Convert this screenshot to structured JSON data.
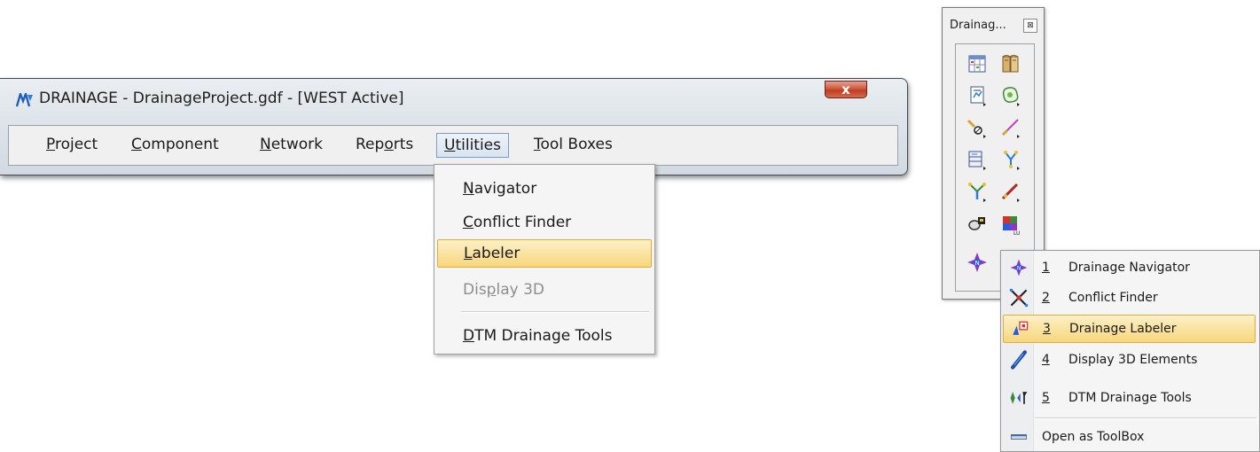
{
  "window": {
    "title": "DRAINAGE - DrainageProject.gdf - [WEST Active]",
    "close_label": "x",
    "menu": [
      {
        "pre": "",
        "key": "P",
        "post": "roject"
      },
      {
        "pre": "",
        "key": "C",
        "post": "omponent"
      },
      {
        "pre": "",
        "key": "N",
        "post": "etwork"
      },
      {
        "pre": "Rep",
        "key": "o",
        "post": "rts"
      },
      {
        "pre": "",
        "key": "U",
        "post": "tilities"
      },
      {
        "pre": "",
        "key": "T",
        "post": "ool Boxes"
      }
    ]
  },
  "utilities_menu": {
    "items": [
      {
        "pre": "",
        "key": "N",
        "post": "avigator"
      },
      {
        "pre": "",
        "key": "C",
        "post": "onflict Finder"
      },
      {
        "pre": "",
        "key": "L",
        "post": "abeler"
      },
      {
        "pre": "Dis",
        "key": "p",
        "post": "lay 3D"
      },
      {
        "pre": "",
        "key": "D",
        "post": "TM Drainage Tools"
      }
    ]
  },
  "toolbox": {
    "title": "Drainag...",
    "close_label": "⊠"
  },
  "popup": {
    "items": [
      {
        "num": "1",
        "label": "Drainage Navigator"
      },
      {
        "num": "2",
        "label": "Conflict Finder"
      },
      {
        "num": "3",
        "label": "Drainage Labeler"
      },
      {
        "num": "4",
        "label": "Display 3D Elements"
      },
      {
        "num": "5",
        "label": "DTM Drainage Tools"
      },
      {
        "num": "",
        "label": "Open as ToolBox"
      }
    ]
  },
  "colors": {
    "highlight": "#f7d77c",
    "highlight_border": "#e3ac3a",
    "close_red": "#c03e22"
  }
}
